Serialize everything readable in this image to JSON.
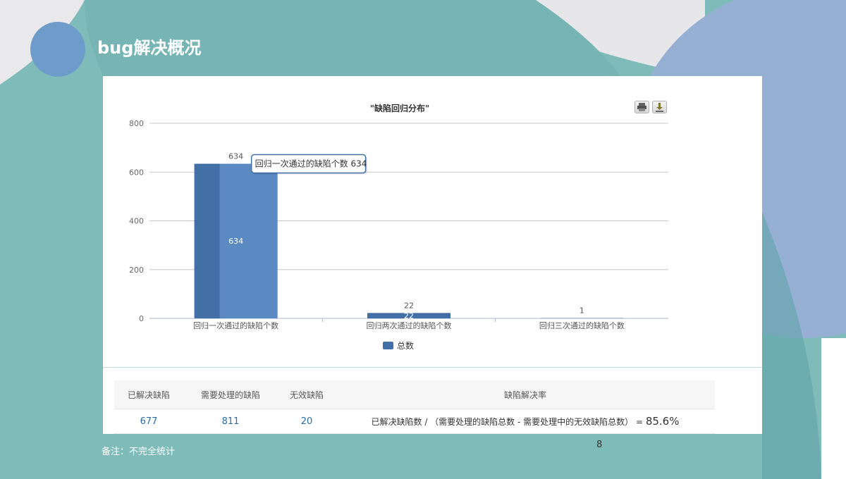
{
  "slide": {
    "title": "bug解决概况",
    "footnote": "备注：不完全统计",
    "page_number": "8"
  },
  "colors": {
    "background_teal": "#7fbcb9",
    "blob_blue": "#8fa9d1",
    "bar_primary": "#5b8ac2",
    "bar_shade": "#4270a6"
  },
  "chart_data": {
    "type": "bar",
    "title": "\"缺陷回归分布\"",
    "categories": [
      "回归一次通过的缺陷个数",
      "回归两次通过的缺陷个数",
      "回归三次通过的缺陷个数"
    ],
    "series": [
      {
        "name": "总数",
        "values": [
          634,
          22,
          1
        ]
      }
    ],
    "ylim": [
      0,
      800
    ],
    "yticks": [
      "0",
      "200",
      "400",
      "600",
      "800"
    ],
    "grid": true,
    "legend": "bottom-center",
    "tooltip": {
      "category_index": 0,
      "text": "回归一次通过的缺陷个数 634"
    },
    "toolbar_icons": [
      "print-icon",
      "download-icon"
    ]
  },
  "stats_table": {
    "headers": [
      "已解决缺陷",
      "需要处理的缺陷",
      "无效缺陷",
      "缺陷解决率"
    ],
    "values": [
      "677",
      "811",
      "20"
    ],
    "rate_formula": "已解决缺陷数 / （需要处理的缺陷总数 - 需要处理中的无效缺陷总数） = ",
    "rate_value": "85.6%"
  }
}
